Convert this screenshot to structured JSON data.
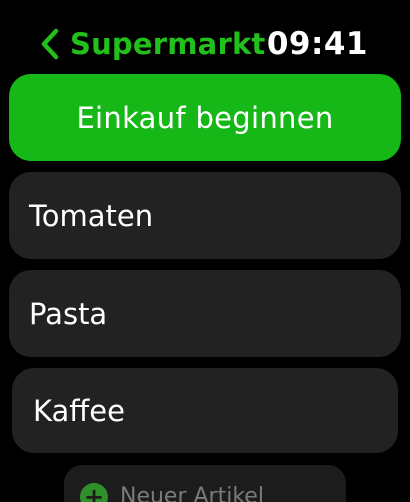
{
  "header": {
    "back_title": "Supermarkt",
    "time": "09:41"
  },
  "primary_action": {
    "label": "Einkauf beginnen"
  },
  "list": {
    "items": [
      {
        "label": "Tomaten"
      },
      {
        "label": "Pasta"
      },
      {
        "label": "Kaffee"
      }
    ]
  },
  "new_item": {
    "label": "Neuer Artikel"
  },
  "colors": {
    "accent": "#16b818",
    "background": "#000000",
    "row_background": "#222222"
  },
  "icons": {
    "back": "chevron-left-icon",
    "add": "plus-circle-icon"
  }
}
